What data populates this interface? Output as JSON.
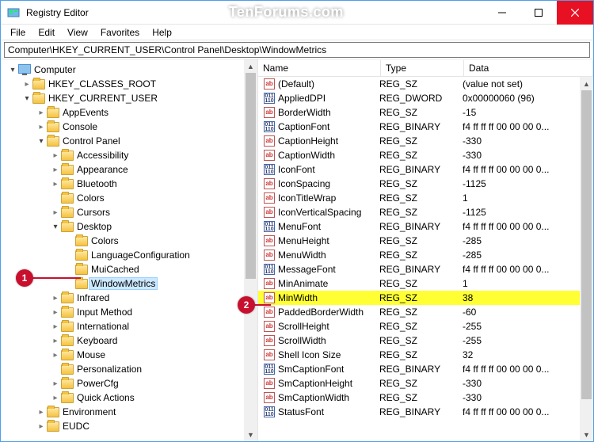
{
  "window": {
    "title": "Registry Editor",
    "watermark": "TenForums.com"
  },
  "menu": [
    "File",
    "Edit",
    "View",
    "Favorites",
    "Help"
  ],
  "addressPath": "Computer\\HKEY_CURRENT_USER\\Control Panel\\Desktop\\WindowMetrics",
  "callouts": {
    "one": "1",
    "two": "2"
  },
  "tree": [
    {
      "depth": 0,
      "arrow": "open",
      "icon": "pc",
      "label": "Computer"
    },
    {
      "depth": 1,
      "arrow": "closed",
      "icon": "folder",
      "label": "HKEY_CLASSES_ROOT"
    },
    {
      "depth": 1,
      "arrow": "open",
      "icon": "folder",
      "label": "HKEY_CURRENT_USER"
    },
    {
      "depth": 2,
      "arrow": "closed",
      "icon": "folder",
      "label": "AppEvents"
    },
    {
      "depth": 2,
      "arrow": "closed",
      "icon": "folder",
      "label": "Console"
    },
    {
      "depth": 2,
      "arrow": "open",
      "icon": "folder",
      "label": "Control Panel"
    },
    {
      "depth": 3,
      "arrow": "closed",
      "icon": "folder",
      "label": "Accessibility"
    },
    {
      "depth": 3,
      "arrow": "closed",
      "icon": "folder",
      "label": "Appearance"
    },
    {
      "depth": 3,
      "arrow": "closed",
      "icon": "folder",
      "label": "Bluetooth"
    },
    {
      "depth": 3,
      "arrow": "none",
      "icon": "folder",
      "label": "Colors"
    },
    {
      "depth": 3,
      "arrow": "closed",
      "icon": "folder",
      "label": "Cursors"
    },
    {
      "depth": 3,
      "arrow": "open",
      "icon": "folder",
      "label": "Desktop"
    },
    {
      "depth": 4,
      "arrow": "none",
      "icon": "folder",
      "label": "Colors"
    },
    {
      "depth": 4,
      "arrow": "none",
      "icon": "folder",
      "label": "LanguageConfiguration"
    },
    {
      "depth": 4,
      "arrow": "none",
      "icon": "folder",
      "label": "MuiCached"
    },
    {
      "depth": 4,
      "arrow": "none",
      "icon": "folder",
      "label": "WindowMetrics",
      "selected": true
    },
    {
      "depth": 3,
      "arrow": "closed",
      "icon": "folder",
      "label": "Infrared"
    },
    {
      "depth": 3,
      "arrow": "closed",
      "icon": "folder",
      "label": "Input Method"
    },
    {
      "depth": 3,
      "arrow": "closed",
      "icon": "folder",
      "label": "International"
    },
    {
      "depth": 3,
      "arrow": "closed",
      "icon": "folder",
      "label": "Keyboard"
    },
    {
      "depth": 3,
      "arrow": "closed",
      "icon": "folder",
      "label": "Mouse"
    },
    {
      "depth": 3,
      "arrow": "none",
      "icon": "folder",
      "label": "Personalization"
    },
    {
      "depth": 3,
      "arrow": "closed",
      "icon": "folder",
      "label": "PowerCfg"
    },
    {
      "depth": 3,
      "arrow": "closed",
      "icon": "folder",
      "label": "Quick Actions"
    },
    {
      "depth": 2,
      "arrow": "closed",
      "icon": "folder",
      "label": "Environment"
    },
    {
      "depth": 2,
      "arrow": "closed",
      "icon": "folder",
      "label": "EUDC"
    }
  ],
  "listHeaders": {
    "name": "Name",
    "type": "Type",
    "data": "Data"
  },
  "values": [
    {
      "icon": "str",
      "name": "(Default)",
      "type": "REG_SZ",
      "data": "(value not set)"
    },
    {
      "icon": "bin",
      "name": "AppliedDPI",
      "type": "REG_DWORD",
      "data": "0x00000060 (96)"
    },
    {
      "icon": "str",
      "name": "BorderWidth",
      "type": "REG_SZ",
      "data": "-15"
    },
    {
      "icon": "bin",
      "name": "CaptionFont",
      "type": "REG_BINARY",
      "data": "f4 ff ff ff 00 00 00 0..."
    },
    {
      "icon": "str",
      "name": "CaptionHeight",
      "type": "REG_SZ",
      "data": "-330"
    },
    {
      "icon": "str",
      "name": "CaptionWidth",
      "type": "REG_SZ",
      "data": "-330"
    },
    {
      "icon": "bin",
      "name": "IconFont",
      "type": "REG_BINARY",
      "data": "f4 ff ff ff 00 00 00 0..."
    },
    {
      "icon": "str",
      "name": "IconSpacing",
      "type": "REG_SZ",
      "data": "-1125"
    },
    {
      "icon": "str",
      "name": "IconTitleWrap",
      "type": "REG_SZ",
      "data": "1"
    },
    {
      "icon": "str",
      "name": "IconVerticalSpacing",
      "type": "REG_SZ",
      "data": "-1125"
    },
    {
      "icon": "bin",
      "name": "MenuFont",
      "type": "REG_BINARY",
      "data": "f4 ff ff ff 00 00 00 0..."
    },
    {
      "icon": "str",
      "name": "MenuHeight",
      "type": "REG_SZ",
      "data": "-285"
    },
    {
      "icon": "str",
      "name": "MenuWidth",
      "type": "REG_SZ",
      "data": "-285"
    },
    {
      "icon": "bin",
      "name": "MessageFont",
      "type": "REG_BINARY",
      "data": "f4 ff ff ff 00 00 00 0..."
    },
    {
      "icon": "str",
      "name": "MinAnimate",
      "type": "REG_SZ",
      "data": "1"
    },
    {
      "icon": "str",
      "name": "MinWidth",
      "type": "REG_SZ",
      "data": "38",
      "hl": true
    },
    {
      "icon": "str",
      "name": "PaddedBorderWidth",
      "type": "REG_SZ",
      "data": "-60"
    },
    {
      "icon": "str",
      "name": "ScrollHeight",
      "type": "REG_SZ",
      "data": "-255"
    },
    {
      "icon": "str",
      "name": "ScrollWidth",
      "type": "REG_SZ",
      "data": "-255"
    },
    {
      "icon": "str",
      "name": "Shell Icon Size",
      "type": "REG_SZ",
      "data": "32"
    },
    {
      "icon": "bin",
      "name": "SmCaptionFont",
      "type": "REG_BINARY",
      "data": "f4 ff ff ff 00 00 00 0..."
    },
    {
      "icon": "str",
      "name": "SmCaptionHeight",
      "type": "REG_SZ",
      "data": "-330"
    },
    {
      "icon": "str",
      "name": "SmCaptionWidth",
      "type": "REG_SZ",
      "data": "-330"
    },
    {
      "icon": "bin",
      "name": "StatusFont",
      "type": "REG_BINARY",
      "data": "f4 ff ff ff 00 00 00 0..."
    }
  ]
}
